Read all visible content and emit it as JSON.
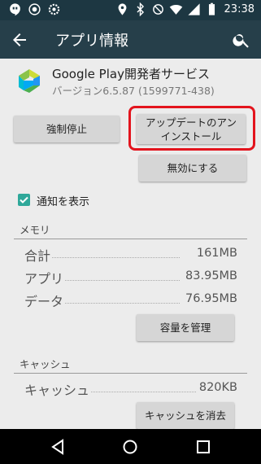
{
  "status_bar": {
    "time": "23:38",
    "icons": [
      "hangouts-icon",
      "notification-icon",
      "settings-icon",
      "location-icon",
      "bluetooth-icon",
      "do-not-disturb-icon",
      "wifi-icon",
      "signal-icon",
      "battery-icon"
    ]
  },
  "app_bar": {
    "title": "アプリ情報",
    "back_icon": "arrow-back-icon",
    "search_icon": "search-icon"
  },
  "app": {
    "name": "Google Play開発者サービス",
    "version": "バージョン6.5.87 (1599771-438)",
    "icon": "google-play-services-icon"
  },
  "buttons": {
    "force_stop": "強制停止",
    "uninstall_updates": "アップデートのアン\nインストール",
    "disable": "無効にする",
    "manage_space": "容量を管理",
    "clear_cache": "キャッシュを消去"
  },
  "notifications": {
    "label": "通知を表示",
    "checked": true
  },
  "storage": {
    "title": "メモリ",
    "rows": [
      {
        "label": "合計",
        "value": "161MB"
      },
      {
        "label": "アプリ",
        "value": "83.95MB"
      },
      {
        "label": "データ",
        "value": "76.95MB"
      }
    ]
  },
  "cache": {
    "title": "キャッシュ",
    "label": "キャッシュ",
    "value": "820KB"
  },
  "highlight_color": "#e3141d",
  "accent_color": "#2fa89a"
}
